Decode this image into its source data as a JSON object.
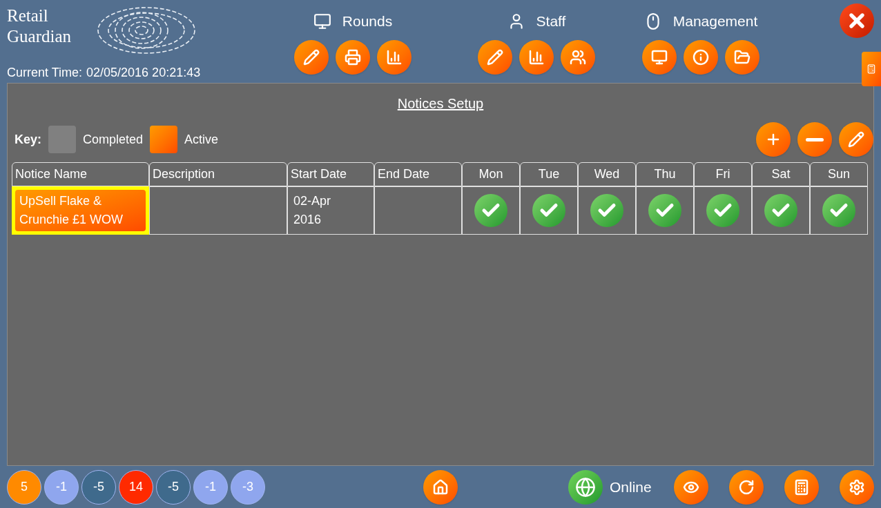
{
  "logo": {
    "line1": "Retail",
    "line2": "Guardian"
  },
  "current_time": {
    "label": "Current Time:",
    "value": "02/05/2016 20:21:43"
  },
  "menu_groups": [
    {
      "title": "Rounds",
      "kind": "rounds",
      "buttons": [
        {
          "kind": "edit"
        },
        {
          "kind": "print"
        },
        {
          "kind": "chart"
        }
      ]
    },
    {
      "title": "Staff",
      "kind": "staff",
      "buttons": [
        {
          "kind": "edit"
        },
        {
          "kind": "chart"
        },
        {
          "kind": "users"
        }
      ]
    },
    {
      "title": "Management",
      "kind": "management",
      "buttons": [
        {
          "kind": "monitor"
        },
        {
          "kind": "info"
        },
        {
          "kind": "folder"
        }
      ]
    }
  ],
  "page_title": "Notices Setup",
  "key": {
    "label": "Key:",
    "items": [
      {
        "label": "Completed",
        "kind": "completed"
      },
      {
        "label": "Active",
        "kind": "active"
      }
    ]
  },
  "table": {
    "columns": [
      "Notice Name",
      "Description",
      "Start Date",
      "End Date",
      "Mon",
      "Tue",
      "Wed",
      "Thu",
      "Fri",
      "Sat",
      "Sun"
    ],
    "rows": [
      {
        "name": "UpSell Flake & Crunchie £1 WOW",
        "kind": "active",
        "selected": true,
        "description": "",
        "start_date": "02-Apr 2016",
        "end_date": "",
        "days": [
          {
            "checked": true
          },
          {
            "checked": true
          },
          {
            "checked": true
          },
          {
            "checked": true
          },
          {
            "checked": true
          },
          {
            "checked": true
          },
          {
            "checked": true
          }
        ]
      }
    ]
  },
  "counters": [
    {
      "value": "5",
      "color": "#ff8a00"
    },
    {
      "value": "-1",
      "color": "#8fa6ee"
    },
    {
      "value": "-5",
      "color": "#3f6a8c"
    },
    {
      "value": "14",
      "color": "#ff2a00"
    },
    {
      "value": "-5",
      "color": "#3f6a8c"
    },
    {
      "value": "-1",
      "color": "#8fa6ee"
    },
    {
      "value": "-3",
      "color": "#8fa6ee"
    }
  ],
  "status": {
    "label": "Online",
    "online": true
  }
}
